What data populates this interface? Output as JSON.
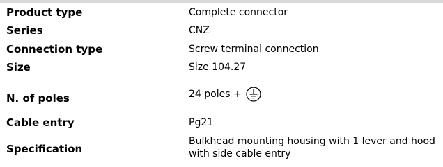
{
  "rows": [
    {
      "key": "Product type",
      "value": "Complete connector"
    },
    {
      "key": "Series",
      "value": "CNZ"
    },
    {
      "key": "Connection type",
      "value": "Screw terminal connection"
    },
    {
      "key": "Size",
      "value": "Size 104.27"
    },
    {
      "key": "N. of poles",
      "value": "24 poles +",
      "icon": "protective-earth-ground-icon"
    },
    {
      "key": "Cable entry",
      "value": "Pg21"
    },
    {
      "key": "Specification",
      "value": "Bulkhead mounting housing with 1 lever and hood with side cable entry"
    }
  ]
}
